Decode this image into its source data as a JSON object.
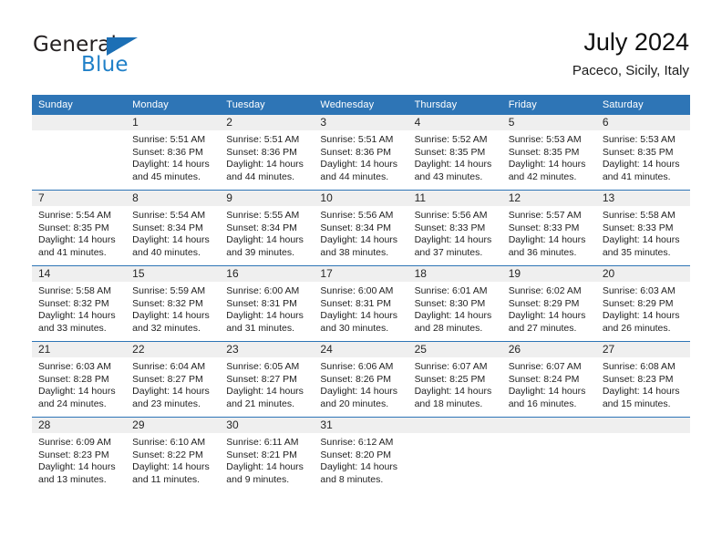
{
  "logo": {
    "word_1": "General",
    "word_2": "Blue",
    "triangle_icon": "triangle-icon",
    "brand_blue": "#2080c8",
    "brand_dark": "#231f20"
  },
  "header": {
    "title": "July 2024",
    "subtitle": "Paceco, Sicily, Italy"
  },
  "theme": {
    "header_blue": "#2e75b6",
    "daynum_band": "#efefef",
    "cell_background": "#ffffff",
    "text": "#1f1f1f"
  },
  "calendar": {
    "weekdays": [
      "Sunday",
      "Monday",
      "Tuesday",
      "Wednesday",
      "Thursday",
      "Friday",
      "Saturday"
    ],
    "weeks": [
      [
        {
          "day": "",
          "empty": true,
          "sunrise": "",
          "sunset": "",
          "daylight_1": "",
          "daylight_2": ""
        },
        {
          "day": "1",
          "empty": false,
          "sunrise": "Sunrise: 5:51 AM",
          "sunset": "Sunset: 8:36 PM",
          "daylight_1": "Daylight: 14 hours",
          "daylight_2": "and 45 minutes."
        },
        {
          "day": "2",
          "empty": false,
          "sunrise": "Sunrise: 5:51 AM",
          "sunset": "Sunset: 8:36 PM",
          "daylight_1": "Daylight: 14 hours",
          "daylight_2": "and 44 minutes."
        },
        {
          "day": "3",
          "empty": false,
          "sunrise": "Sunrise: 5:51 AM",
          "sunset": "Sunset: 8:36 PM",
          "daylight_1": "Daylight: 14 hours",
          "daylight_2": "and 44 minutes."
        },
        {
          "day": "4",
          "empty": false,
          "sunrise": "Sunrise: 5:52 AM",
          "sunset": "Sunset: 8:35 PM",
          "daylight_1": "Daylight: 14 hours",
          "daylight_2": "and 43 minutes."
        },
        {
          "day": "5",
          "empty": false,
          "sunrise": "Sunrise: 5:53 AM",
          "sunset": "Sunset: 8:35 PM",
          "daylight_1": "Daylight: 14 hours",
          "daylight_2": "and 42 minutes."
        },
        {
          "day": "6",
          "empty": false,
          "sunrise": "Sunrise: 5:53 AM",
          "sunset": "Sunset: 8:35 PM",
          "daylight_1": "Daylight: 14 hours",
          "daylight_2": "and 41 minutes."
        }
      ],
      [
        {
          "day": "7",
          "empty": false,
          "sunrise": "Sunrise: 5:54 AM",
          "sunset": "Sunset: 8:35 PM",
          "daylight_1": "Daylight: 14 hours",
          "daylight_2": "and 41 minutes."
        },
        {
          "day": "8",
          "empty": false,
          "sunrise": "Sunrise: 5:54 AM",
          "sunset": "Sunset: 8:34 PM",
          "daylight_1": "Daylight: 14 hours",
          "daylight_2": "and 40 minutes."
        },
        {
          "day": "9",
          "empty": false,
          "sunrise": "Sunrise: 5:55 AM",
          "sunset": "Sunset: 8:34 PM",
          "daylight_1": "Daylight: 14 hours",
          "daylight_2": "and 39 minutes."
        },
        {
          "day": "10",
          "empty": false,
          "sunrise": "Sunrise: 5:56 AM",
          "sunset": "Sunset: 8:34 PM",
          "daylight_1": "Daylight: 14 hours",
          "daylight_2": "and 38 minutes."
        },
        {
          "day": "11",
          "empty": false,
          "sunrise": "Sunrise: 5:56 AM",
          "sunset": "Sunset: 8:33 PM",
          "daylight_1": "Daylight: 14 hours",
          "daylight_2": "and 37 minutes."
        },
        {
          "day": "12",
          "empty": false,
          "sunrise": "Sunrise: 5:57 AM",
          "sunset": "Sunset: 8:33 PM",
          "daylight_1": "Daylight: 14 hours",
          "daylight_2": "and 36 minutes."
        },
        {
          "day": "13",
          "empty": false,
          "sunrise": "Sunrise: 5:58 AM",
          "sunset": "Sunset: 8:33 PM",
          "daylight_1": "Daylight: 14 hours",
          "daylight_2": "and 35 minutes."
        }
      ],
      [
        {
          "day": "14",
          "empty": false,
          "sunrise": "Sunrise: 5:58 AM",
          "sunset": "Sunset: 8:32 PM",
          "daylight_1": "Daylight: 14 hours",
          "daylight_2": "and 33 minutes."
        },
        {
          "day": "15",
          "empty": false,
          "sunrise": "Sunrise: 5:59 AM",
          "sunset": "Sunset: 8:32 PM",
          "daylight_1": "Daylight: 14 hours",
          "daylight_2": "and 32 minutes."
        },
        {
          "day": "16",
          "empty": false,
          "sunrise": "Sunrise: 6:00 AM",
          "sunset": "Sunset: 8:31 PM",
          "daylight_1": "Daylight: 14 hours",
          "daylight_2": "and 31 minutes."
        },
        {
          "day": "17",
          "empty": false,
          "sunrise": "Sunrise: 6:00 AM",
          "sunset": "Sunset: 8:31 PM",
          "daylight_1": "Daylight: 14 hours",
          "daylight_2": "and 30 minutes."
        },
        {
          "day": "18",
          "empty": false,
          "sunrise": "Sunrise: 6:01 AM",
          "sunset": "Sunset: 8:30 PM",
          "daylight_1": "Daylight: 14 hours",
          "daylight_2": "and 28 minutes."
        },
        {
          "day": "19",
          "empty": false,
          "sunrise": "Sunrise: 6:02 AM",
          "sunset": "Sunset: 8:29 PM",
          "daylight_1": "Daylight: 14 hours",
          "daylight_2": "and 27 minutes."
        },
        {
          "day": "20",
          "empty": false,
          "sunrise": "Sunrise: 6:03 AM",
          "sunset": "Sunset: 8:29 PM",
          "daylight_1": "Daylight: 14 hours",
          "daylight_2": "and 26 minutes."
        }
      ],
      [
        {
          "day": "21",
          "empty": false,
          "sunrise": "Sunrise: 6:03 AM",
          "sunset": "Sunset: 8:28 PM",
          "daylight_1": "Daylight: 14 hours",
          "daylight_2": "and 24 minutes."
        },
        {
          "day": "22",
          "empty": false,
          "sunrise": "Sunrise: 6:04 AM",
          "sunset": "Sunset: 8:27 PM",
          "daylight_1": "Daylight: 14 hours",
          "daylight_2": "and 23 minutes."
        },
        {
          "day": "23",
          "empty": false,
          "sunrise": "Sunrise: 6:05 AM",
          "sunset": "Sunset: 8:27 PM",
          "daylight_1": "Daylight: 14 hours",
          "daylight_2": "and 21 minutes."
        },
        {
          "day": "24",
          "empty": false,
          "sunrise": "Sunrise: 6:06 AM",
          "sunset": "Sunset: 8:26 PM",
          "daylight_1": "Daylight: 14 hours",
          "daylight_2": "and 20 minutes."
        },
        {
          "day": "25",
          "empty": false,
          "sunrise": "Sunrise: 6:07 AM",
          "sunset": "Sunset: 8:25 PM",
          "daylight_1": "Daylight: 14 hours",
          "daylight_2": "and 18 minutes."
        },
        {
          "day": "26",
          "empty": false,
          "sunrise": "Sunrise: 6:07 AM",
          "sunset": "Sunset: 8:24 PM",
          "daylight_1": "Daylight: 14 hours",
          "daylight_2": "and 16 minutes."
        },
        {
          "day": "27",
          "empty": false,
          "sunrise": "Sunrise: 6:08 AM",
          "sunset": "Sunset: 8:23 PM",
          "daylight_1": "Daylight: 14 hours",
          "daylight_2": "and 15 minutes."
        }
      ],
      [
        {
          "day": "28",
          "empty": false,
          "sunrise": "Sunrise: 6:09 AM",
          "sunset": "Sunset: 8:23 PM",
          "daylight_1": "Daylight: 14 hours",
          "daylight_2": "and 13 minutes."
        },
        {
          "day": "29",
          "empty": false,
          "sunrise": "Sunrise: 6:10 AM",
          "sunset": "Sunset: 8:22 PM",
          "daylight_1": "Daylight: 14 hours",
          "daylight_2": "and 11 minutes."
        },
        {
          "day": "30",
          "empty": false,
          "sunrise": "Sunrise: 6:11 AM",
          "sunset": "Sunset: 8:21 PM",
          "daylight_1": "Daylight: 14 hours",
          "daylight_2": "and 9 minutes."
        },
        {
          "day": "31",
          "empty": false,
          "sunrise": "Sunrise: 6:12 AM",
          "sunset": "Sunset: 8:20 PM",
          "daylight_1": "Daylight: 14 hours",
          "daylight_2": "and 8 minutes."
        },
        {
          "day": "",
          "empty": true,
          "sunrise": "",
          "sunset": "",
          "daylight_1": "",
          "daylight_2": ""
        },
        {
          "day": "",
          "empty": true,
          "sunrise": "",
          "sunset": "",
          "daylight_1": "",
          "daylight_2": ""
        },
        {
          "day": "",
          "empty": true,
          "sunrise": "",
          "sunset": "",
          "daylight_1": "",
          "daylight_2": ""
        }
      ]
    ]
  }
}
